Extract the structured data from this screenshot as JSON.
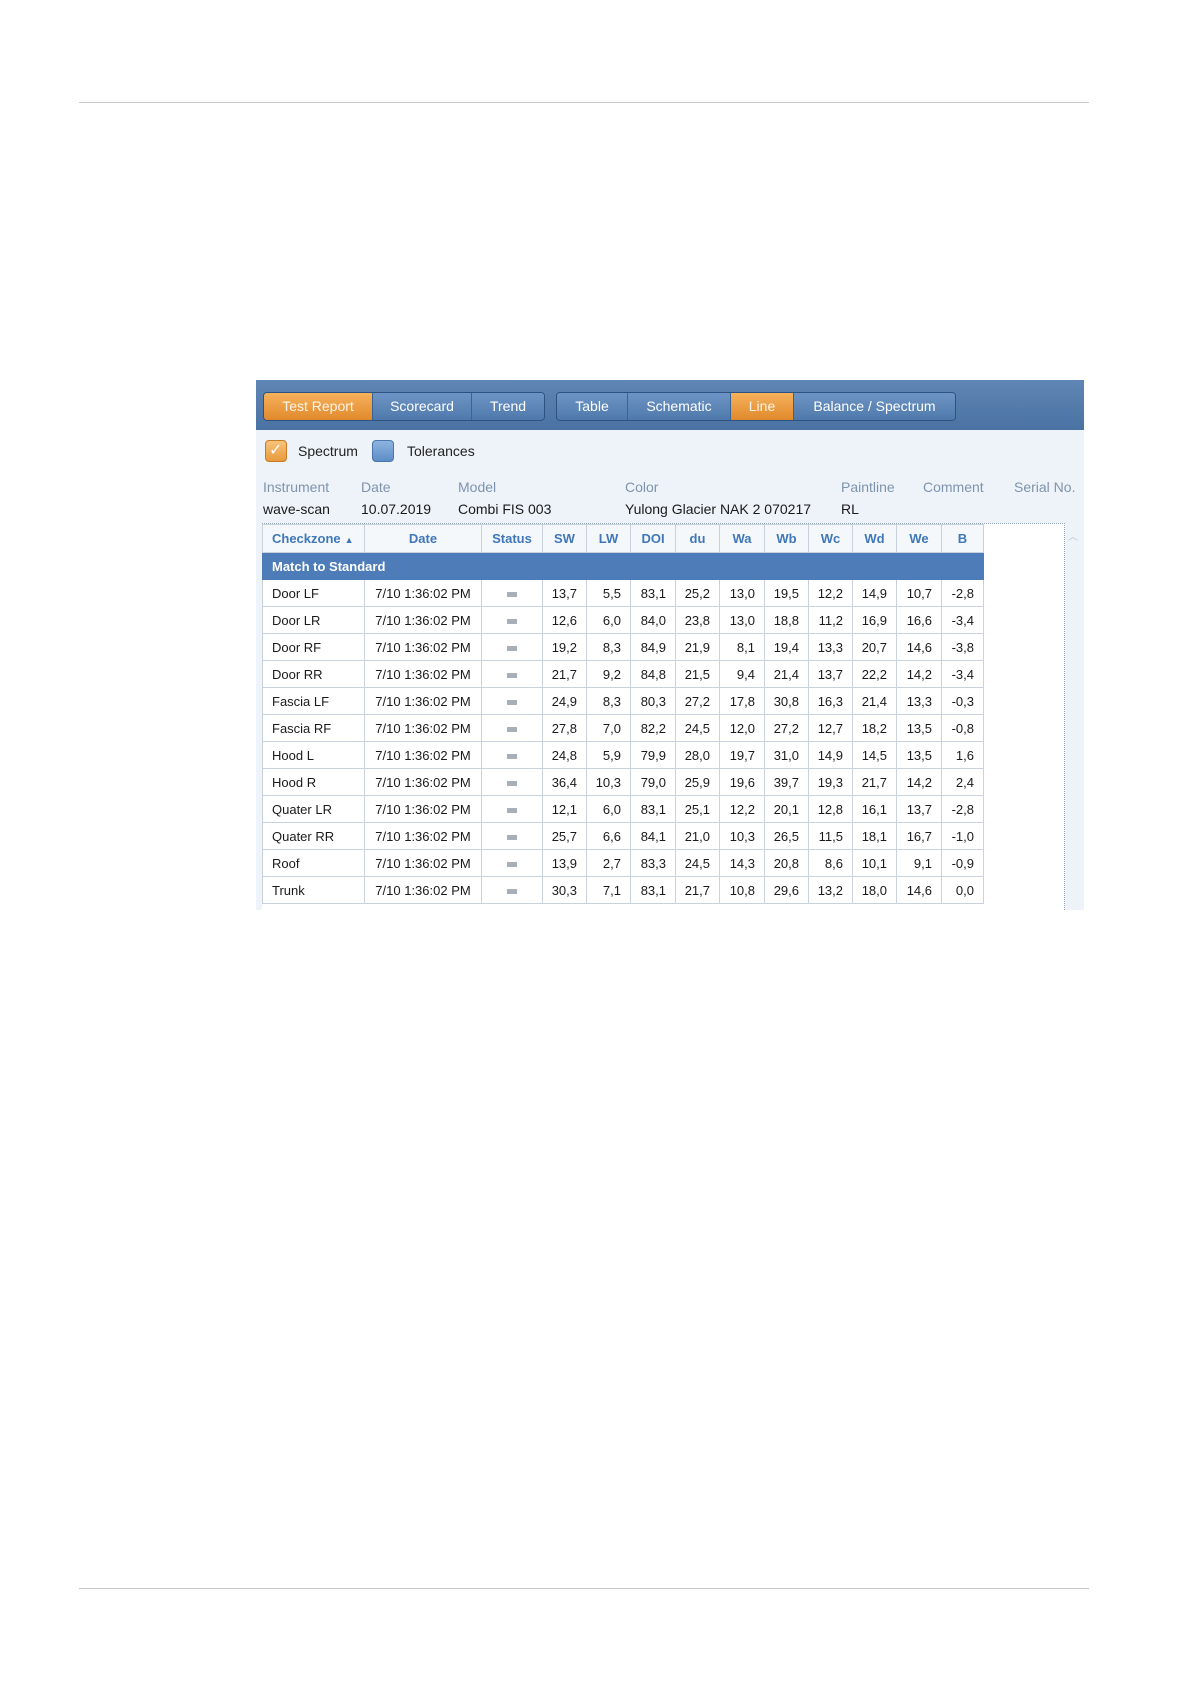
{
  "toolbar": {
    "view_tabs": [
      {
        "label": "Test Report",
        "active": true
      },
      {
        "label": "Scorecard",
        "active": false
      },
      {
        "label": "Trend",
        "active": false
      }
    ],
    "display_tabs": [
      {
        "label": "Table",
        "active": false
      },
      {
        "label": "Schematic",
        "active": false
      },
      {
        "label": "Line",
        "active": true
      },
      {
        "label": "Balance / Spectrum",
        "active": false
      }
    ]
  },
  "options": {
    "spectrum_label": "Spectrum",
    "spectrum_checked": true,
    "tolerances_label": "Tolerances",
    "tolerances_checked": false
  },
  "info": {
    "headers": {
      "instrument": "Instrument",
      "date": "Date",
      "model": "Model",
      "color": "Color",
      "paintline": "Paintline",
      "comment": "Comment",
      "serial": "Serial No."
    },
    "values": {
      "instrument": "wave-scan",
      "date": "10.07.2019",
      "model": "Combi FIS 003",
      "color": "Yulong Glacier NAK 2 070217",
      "paintline": "RL",
      "comment": "",
      "serial": ""
    }
  },
  "grid": {
    "sort_arrow": "▲",
    "columns": [
      "Checkzone",
      "Date",
      "Status",
      "SW",
      "LW",
      "DOI",
      "du",
      "Wa",
      "Wb",
      "Wc",
      "Wd",
      "We",
      "B"
    ],
    "group_label": "Match to Standard",
    "rows": [
      [
        "Door LF",
        "7/10 1:36:02 PM",
        "13,7",
        "5,5",
        "83,1",
        "25,2",
        "13,0",
        "19,5",
        "12,2",
        "14,9",
        "10,7",
        "-2,8"
      ],
      [
        "Door LR",
        "7/10 1:36:02 PM",
        "12,6",
        "6,0",
        "84,0",
        "23,8",
        "13,0",
        "18,8",
        "11,2",
        "16,9",
        "16,6",
        "-3,4"
      ],
      [
        "Door RF",
        "7/10 1:36:02 PM",
        "19,2",
        "8,3",
        "84,9",
        "21,9",
        "8,1",
        "19,4",
        "13,3",
        "20,7",
        "14,6",
        "-3,8"
      ],
      [
        "Door RR",
        "7/10 1:36:02 PM",
        "21,7",
        "9,2",
        "84,8",
        "21,5",
        "9,4",
        "21,4",
        "13,7",
        "22,2",
        "14,2",
        "-3,4"
      ],
      [
        "Fascia LF",
        "7/10 1:36:02 PM",
        "24,9",
        "8,3",
        "80,3",
        "27,2",
        "17,8",
        "30,8",
        "16,3",
        "21,4",
        "13,3",
        "-0,3"
      ],
      [
        "Fascia RF",
        "7/10 1:36:02 PM",
        "27,8",
        "7,0",
        "82,2",
        "24,5",
        "12,0",
        "27,2",
        "12,7",
        "18,2",
        "13,5",
        "-0,8"
      ],
      [
        "Hood L",
        "7/10 1:36:02 PM",
        "24,8",
        "5,9",
        "79,9",
        "28,0",
        "19,7",
        "31,0",
        "14,9",
        "14,5",
        "13,5",
        "1,6"
      ],
      [
        "Hood R",
        "7/10 1:36:02 PM",
        "36,4",
        "10,3",
        "79,0",
        "25,9",
        "19,6",
        "39,7",
        "19,3",
        "21,7",
        "14,2",
        "2,4"
      ],
      [
        "Quater LR",
        "7/10 1:36:02 PM",
        "12,1",
        "6,0",
        "83,1",
        "25,1",
        "12,2",
        "20,1",
        "12,8",
        "16,1",
        "13,7",
        "-2,8"
      ],
      [
        "Quater RR",
        "7/10 1:36:02 PM",
        "25,7",
        "6,6",
        "84,1",
        "21,0",
        "10,3",
        "26,5",
        "11,5",
        "18,1",
        "16,7",
        "-1,0"
      ],
      [
        "Roof",
        "7/10 1:36:02 PM",
        "13,9",
        "2,7",
        "83,3",
        "24,5",
        "14,3",
        "20,8",
        "8,6",
        "10,1",
        "9,1",
        "-0,9"
      ],
      [
        "Trunk",
        "7/10 1:36:02 PM",
        "30,3",
        "7,1",
        "83,1",
        "21,7",
        "10,8",
        "29,6",
        "13,2",
        "18,0",
        "14,6",
        "0,0"
      ]
    ]
  }
}
